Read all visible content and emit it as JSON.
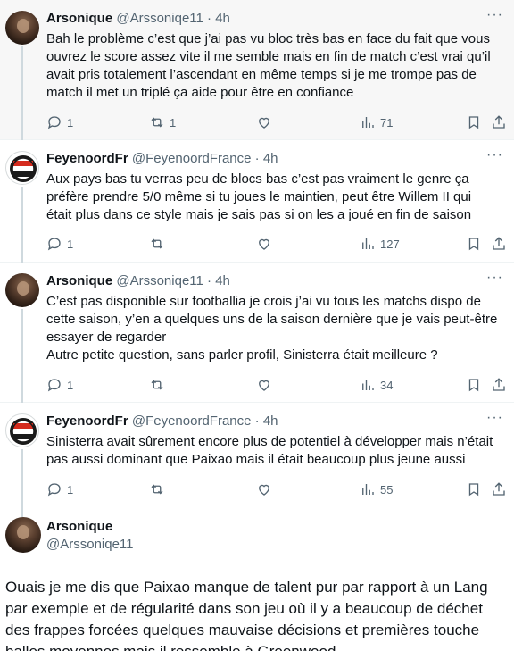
{
  "replies": [
    {
      "name": "Arsonique",
      "handle": "@Arssoniqe11",
      "time": "· 4h",
      "text": "Bah le problème c’est que j’ai pas vu bloc très bas en face du fait que vous ouvrez le score assez vite il me semble mais en fin de match c’est vrai qu’il avait pris totalement l’ascendant en même temps si je me trompe pas de match il met un triplé ça aide pour être en confiance",
      "replies_count": "1",
      "reposts_count": "1",
      "likes_count": "",
      "views_count": "71"
    },
    {
      "name": "FeyenoordFr",
      "handle": "@FeyenoordFrance",
      "time": "· 4h",
      "text": "Aux pays bas tu verras peu de blocs bas c’est pas vraiment le genre ça préfère prendre 5/0 même si tu joues le maintien, peut être Willem II qui était plus dans ce style mais je sais pas si on les a joué en fin de saison",
      "replies_count": "1",
      "reposts_count": "",
      "likes_count": "",
      "views_count": "127"
    },
    {
      "name": "Arsonique",
      "handle": "@Arssoniqe11",
      "time": "· 4h",
      "text": "C’est pas disponible sur footballia je crois j’ai vu tous les matchs dispo de cette saison, y’en a quelques uns de la saison dernière que je vais peut-être essayer de regarder",
      "text2": "Autre petite question, sans parler profil, Sinisterra était meilleure ?",
      "replies_count": "1",
      "reposts_count": "",
      "likes_count": "",
      "views_count": "34"
    },
    {
      "name": "FeyenoordFr",
      "handle": "@FeyenoordFrance",
      "time": "· 4h",
      "text": "Sinisterra avait sûrement encore plus de potentiel à développer mais n’était pas aussi dominant que Paixao mais il était beaucoup plus jeune aussi",
      "replies_count": "1",
      "reposts_count": "",
      "likes_count": "",
      "views_count": "55"
    }
  ],
  "main": {
    "name": "Arsonique",
    "handle": "@Arssoniqe11",
    "text": "Ouais je me dis que Paixao manque de talent pur par rapport à un Lang par exemple et de régularité dans son jeu où il y a beaucoup de déchet des frappes forcées quelques mauvaise décisions et premières touche balles moyennes mais il ressemble à Greenwood"
  },
  "icons": {
    "reply": "reply-icon",
    "repost": "repost-icon",
    "like": "heart-icon",
    "views": "views-icon",
    "bookmark": "bookmark-icon",
    "share": "share-icon",
    "more": "more-icon"
  },
  "colors": {
    "secondary_text": "#536471",
    "highlight_bg": "#f7f7f7",
    "feyenoord_red": "#d52b1e",
    "feyenoord_dark": "#1a1a1a"
  },
  "more_glyph": "···"
}
